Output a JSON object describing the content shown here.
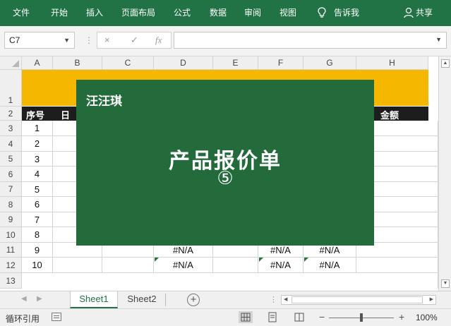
{
  "ribbon": {
    "tabs": [
      "文件",
      "开始",
      "插入",
      "页面布局",
      "公式",
      "数据",
      "审阅",
      "视图"
    ],
    "tell_me": "告诉我",
    "share": "共享",
    "bg": "#217346"
  },
  "formula_bar": {
    "name_box": "C7",
    "cancel_icon": "×",
    "enter_icon": "✓",
    "fx": "fx",
    "value": ""
  },
  "grid": {
    "columns": [
      "A",
      "B",
      "C",
      "D",
      "E",
      "F",
      "G",
      "H"
    ],
    "rows": [
      "1",
      "2",
      "3",
      "4",
      "5",
      "6",
      "7",
      "8",
      "9",
      "10",
      "11",
      "12",
      "13"
    ],
    "header_row": {
      "seq": "序号",
      "date": "日",
      "amount": "金额"
    },
    "seq_values": [
      "1",
      "2",
      "3",
      "4",
      "5",
      "6",
      "7",
      "8",
      "9",
      "10"
    ],
    "na_value": "#N/A",
    "band_color": "#f5b700"
  },
  "overlay": {
    "brand": "汪汪琪",
    "title": "产品报价单",
    "number": "⑤",
    "bg": "#246b3c"
  },
  "sheets": {
    "tabs": [
      "Sheet1",
      "Sheet2"
    ],
    "active": "Sheet1",
    "add": "+"
  },
  "status": {
    "text": "循环引用",
    "zoom": "100%",
    "zoom_minus": "−",
    "zoom_plus": "+"
  }
}
